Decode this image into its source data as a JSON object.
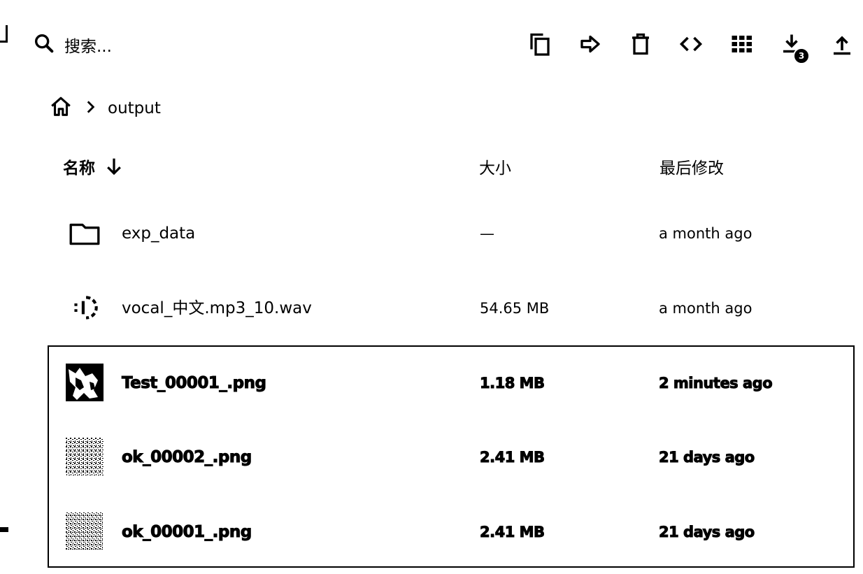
{
  "search": {
    "placeholder": "搜索...",
    "icon": "search-icon"
  },
  "toolbar": {
    "copy_icon": "copy-icon",
    "move_icon": "move-icon",
    "delete_icon": "delete-icon",
    "code_icon": "code-icon",
    "grid_icon": "grid-view-icon",
    "download_icon": "download-icon",
    "download_count": "3",
    "upload_icon": "upload-icon"
  },
  "breadcrumb": {
    "home_icon": "home-icon",
    "current": "output"
  },
  "columns": {
    "name": "名称",
    "size": "大小",
    "modified": "最后修改",
    "sort_icon": "arrow-down-icon"
  },
  "files": [
    {
      "name": "exp_data",
      "size": "—",
      "modified": "a month ago",
      "icon": "folder-icon",
      "selected": false
    },
    {
      "name": "vocal_中文.mp3_10.wav",
      "size": "54.65 MB",
      "modified": "a month ago",
      "icon": "audio-file-icon",
      "selected": false
    },
    {
      "name": "Test_00001_.png",
      "size": "1.18 MB",
      "modified": "2 minutes ago",
      "icon": "image-thumbnail",
      "selected": true
    },
    {
      "name": "ok_00002_.png",
      "size": "2.41 MB",
      "modified": "21 days ago",
      "icon": "image-thumbnail",
      "selected": true
    },
    {
      "name": "ok_00001_.png",
      "size": "2.41 MB",
      "modified": "21 days ago",
      "icon": "image-thumbnail",
      "selected": true
    }
  ]
}
